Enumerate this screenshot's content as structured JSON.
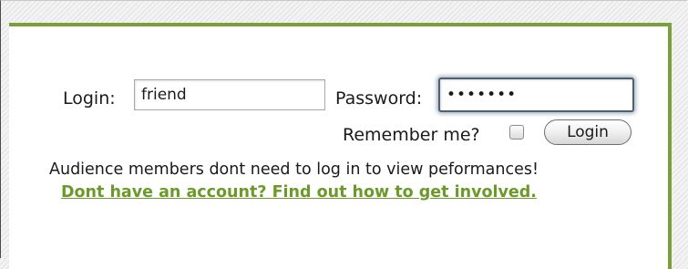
{
  "login_form": {
    "login_label": "Login:",
    "username_value": "friend",
    "password_label": "Password:",
    "password_value": "•••••••",
    "remember_label": "Remember me?",
    "remember_checked": false,
    "login_button_label": "Login"
  },
  "messages": {
    "audience_note": "Audience members dont need to log in to view peformances!",
    "involvement_link": "Dont have an account? Find out how to get involved."
  },
  "colors": {
    "accent_green": "#7aa03a",
    "link_green": "#6b9a2a",
    "focus_ring": "#a8b8c6"
  }
}
